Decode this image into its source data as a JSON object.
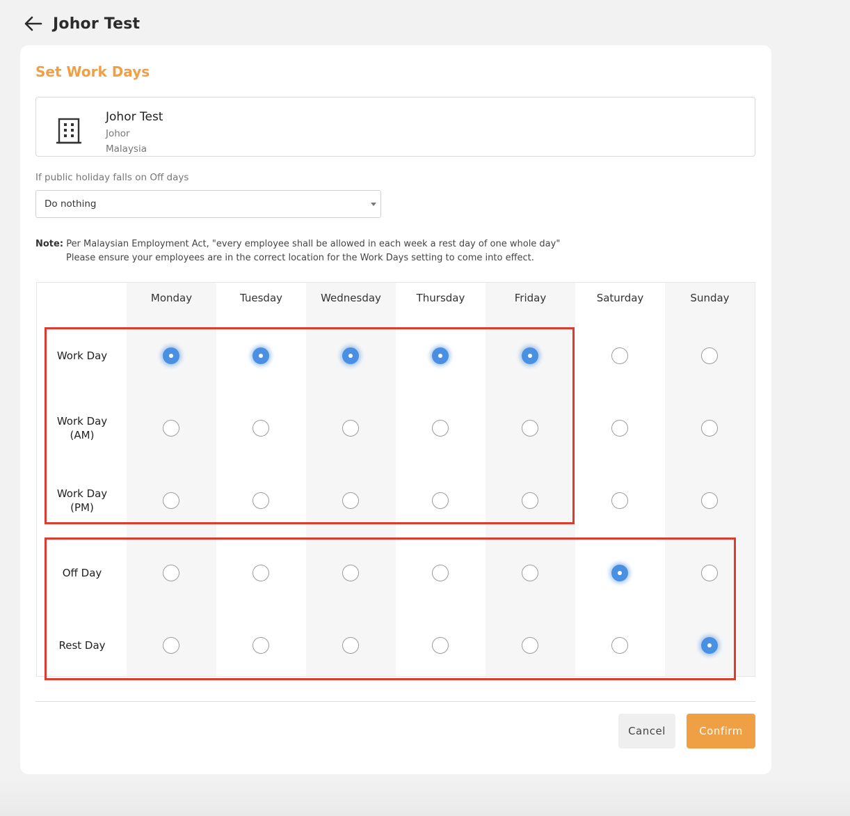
{
  "header": {
    "title": "Johor Test"
  },
  "card": {
    "title": "Set Work Days"
  },
  "location": {
    "name": "Johor Test",
    "state": "Johor",
    "country": "Malaysia"
  },
  "holiday": {
    "label": "If public holiday falls on Off days",
    "selected": "Do nothing"
  },
  "note": {
    "label": "Note:",
    "line1": "Per Malaysian Employment Act, \"every employee shall be allowed in each week a rest day of one whole day\"",
    "line2": "Please ensure your employees are in the correct location for the Work Days setting to come into effect."
  },
  "days": [
    "Monday",
    "Tuesday",
    "Wednesday",
    "Thursday",
    "Friday",
    "Saturday",
    "Sunday"
  ],
  "rows": [
    {
      "line1": "Work Day",
      "line2": ""
    },
    {
      "line1": "Work Day",
      "line2": "(AM)"
    },
    {
      "line1": "Work Day",
      "line2": "(PM)"
    },
    {
      "line1": "Off Day",
      "line2": ""
    },
    {
      "line1": "Rest Day",
      "line2": ""
    }
  ],
  "selection": {
    "Monday": 0,
    "Tuesday": 0,
    "Wednesday": 0,
    "Thursday": 0,
    "Friday": 0,
    "Saturday": 3,
    "Sunday": 4
  },
  "buttons": {
    "cancel": "Cancel",
    "confirm": "Confirm"
  },
  "colors": {
    "accent": "#f0a044",
    "selected_radio": "#4a90e2",
    "highlight_box": "#dc3b2f"
  }
}
